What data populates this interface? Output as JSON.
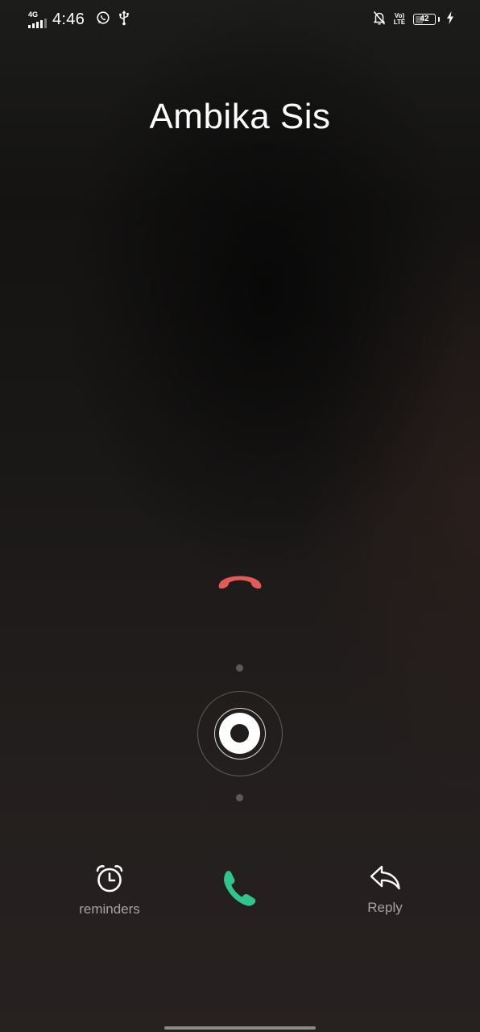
{
  "status_bar": {
    "network_type": "4G",
    "time": "4:46",
    "volte_line1": "Vo)",
    "volte_line2": "LTE",
    "battery_level": "42",
    "battery_fraction": 0.42,
    "icons": [
      "signal-icon",
      "whatsapp-icon",
      "usb-icon",
      "notifications-off-icon",
      "volte-icon",
      "battery-icon",
      "charging-icon"
    ]
  },
  "call": {
    "caller_name": "Ambika Sis"
  },
  "actions": {
    "reminders_label": "reminders",
    "reply_label": "Reply"
  },
  "colors": {
    "decline": "#e45a56",
    "answer": "#2fc58c",
    "label": "#a3a3a3"
  }
}
